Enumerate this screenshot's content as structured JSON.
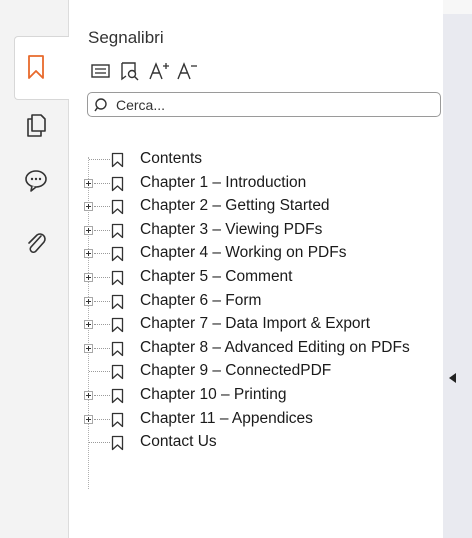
{
  "panel": {
    "title": "Segnalibri",
    "search_placeholder": "Cerca..."
  },
  "rail": {
    "items": [
      {
        "name": "bookmarks",
        "icon": "bookmark-icon",
        "active": true
      },
      {
        "name": "pages",
        "icon": "pages-icon",
        "active": false
      },
      {
        "name": "comments",
        "icon": "comment-icon",
        "active": false
      },
      {
        "name": "attachments",
        "icon": "paperclip-icon",
        "active": false
      }
    ]
  },
  "toolbar": {
    "items": [
      {
        "icon": "list-view-icon"
      },
      {
        "icon": "bookmark-search-icon"
      },
      {
        "icon": "increase-font-icon"
      },
      {
        "icon": "decrease-font-icon"
      }
    ]
  },
  "bookmarks": [
    {
      "label": "Contents",
      "expandable": false
    },
    {
      "label": "Chapter 1 – Introduction",
      "expandable": true
    },
    {
      "label": "Chapter 2 – Getting Started",
      "expandable": true
    },
    {
      "label": "Chapter 3 – Viewing PDFs",
      "expandable": true
    },
    {
      "label": "Chapter 4 – Working on PDFs",
      "expandable": true
    },
    {
      "label": "Chapter 5 – Comment",
      "expandable": true
    },
    {
      "label": "Chapter 6 – Form",
      "expandable": true
    },
    {
      "label": "Chapter 7 – Data Import & Export",
      "expandable": true
    },
    {
      "label": "Chapter 8 – Advanced Editing on PDFs",
      "expandable": true
    },
    {
      "label": "Chapter 9 – ConnectedPDF",
      "expandable": false
    },
    {
      "label": "Chapter 10 – Printing",
      "expandable": true
    },
    {
      "label": "Chapter 11 – Appendices",
      "expandable": true
    },
    {
      "label": "Contact Us",
      "expandable": false
    }
  ],
  "colors": {
    "accent": "#e8692b",
    "rail_bg": "#f3f3f3",
    "right_band": "#e9eaf0"
  }
}
